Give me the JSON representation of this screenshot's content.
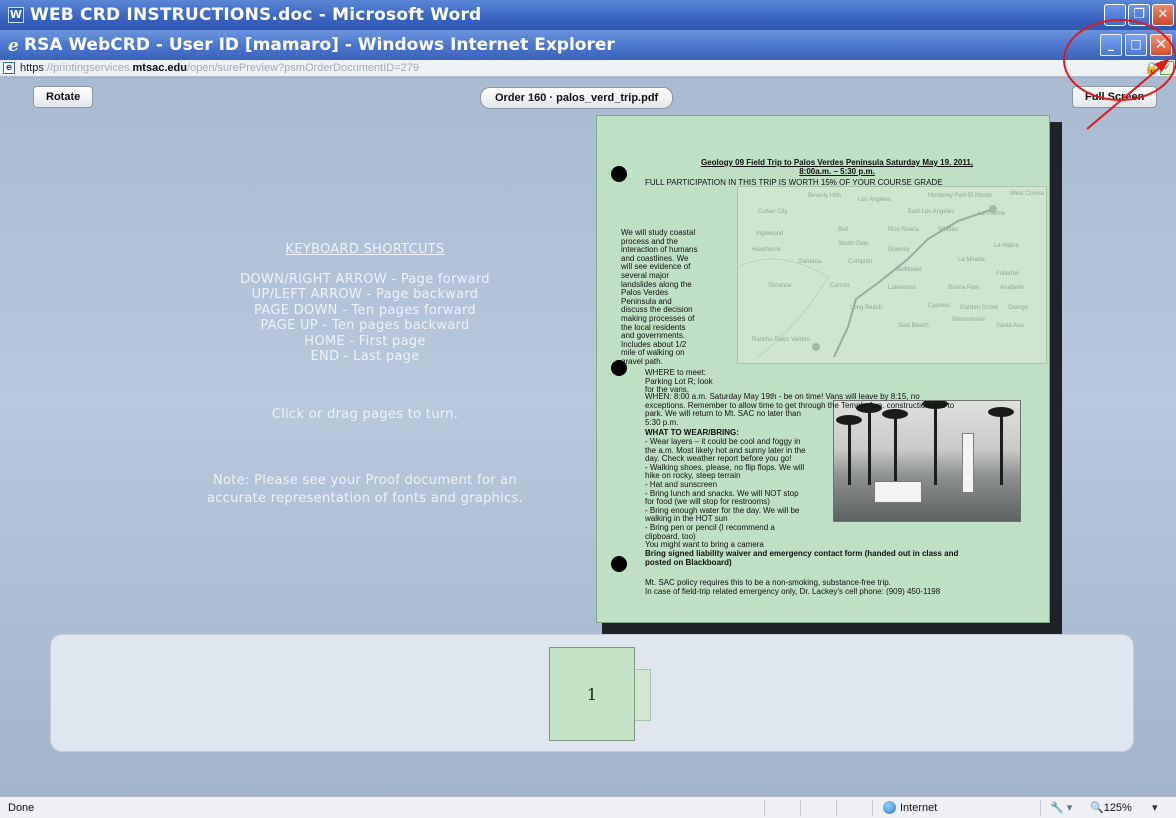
{
  "word_window": {
    "title": "WEB CRD INSTRUCTIONS.doc - Microsoft Word",
    "icon": "word-doc-icon",
    "buttons": {
      "minimize": "_",
      "restore": "❐",
      "close": "✕"
    }
  },
  "ie_window": {
    "title": "RSA WebCRD - User ID [mamaro] - Windows Internet Explorer",
    "icon": "ie-logo-icon",
    "buttons": {
      "minimize": "_",
      "maximize": "□",
      "close": "✕"
    }
  },
  "address_bar": {
    "scheme": "https",
    "sep": "://",
    "host_sub": "printingservices.",
    "host_main": "mtsac.edu",
    "path": "/open/surePreview?psmOrderDocumentID=279"
  },
  "viewer": {
    "rotate_label": "Rotate",
    "order_label": "Order 160 · palos_verd_trip.pdf",
    "fullscreen_label": "Full Screen",
    "shortcuts_title": "KEYBOARD SHORTCUTS",
    "shortcuts": [
      "DOWN/RIGHT ARROW - Page forward",
      "UP/LEFT ARROW - Page backward",
      "PAGE DOWN - Ten pages forward",
      "PAGE UP - Ten pages backward",
      "HOME - First page",
      "END - Last page"
    ],
    "drag_note": "Click or drag pages to turn.",
    "proof_note": "Note: Please see your Proof document for an accurate representation of fonts and graphics."
  },
  "document": {
    "title_line1": "Geology 09 Field Trip to Palos Verdes Peninsula Saturday May 19, 2011,",
    "title_line2": "8:00a.m. – 5:30 p.m.",
    "participation": "FULL PARTICIPATION IN THIS TRIP IS WORTH 15% OF YOUR COURSE GRADE",
    "intro_lines": [
      "We will study coastal",
      "process and the",
      "interaction of humans",
      "and coastlines. We",
      "will see evidence of",
      "several major",
      "landslides along the",
      "Palos Verdes",
      "Peninsula and",
      "discuss the decision",
      "making processes of",
      "the local residents",
      "and governments.",
      "Includes about 1/2",
      "mile of walking on",
      "gravel path."
    ],
    "where_lines": [
      "WHERE to meet:",
      "Parking Lot R; look",
      "for the vans."
    ],
    "when_lines": [
      "WHEN: 8:00 a.m. Saturday May 19th - be on time! Vans will leave by 8:15, no",
      "exceptions. Remember to allow time to get through the Temple Ave. construction and to",
      "park. We will return to Mt. SAC no later than",
      "5:30 p.m."
    ],
    "wear_title": "WHAT TO WEAR/BRING:",
    "wear_lines": [
      "- Wear layers – it could be cool and foggy in",
      "the a.m. Most likely hot and sunny later in the",
      "day. Check weather report before you go!",
      "- Walking shoes, please, no flip flops. We will",
      "hike on rocky, steep terrain",
      "- Hat and sunscreen",
      "- Bring lunch and snacks. We will NOT stop",
      "for food (we will stop for restrooms)",
      "- Bring enough water for the day. We will be",
      "walking in the HOT sun",
      "- Bring pen or pencil (I recommend a",
      "clipboard, too)",
      "You might want to bring a camera"
    ],
    "waiver_lines": [
      "Bring signed liability waiver and emergency contact form (handed out in class and",
      "posted on Blackboard)"
    ],
    "policy_lines": [
      "Mt. SAC policy requires this to be a non-smoking, substance-free trip.",
      "In case of field-trip related emergency only, Dr. Lackey's cell phone: (909) 450-1198"
    ],
    "map_labels": [
      "Beverly Hills",
      "Los Angeles",
      "Monterey Park",
      "El Monte",
      "West Covina",
      "Culver City",
      "East Los Angeles",
      "La Puente",
      "Inglewood",
      "Bell",
      "Pico Rivera",
      "Whittier",
      "Hawthorne",
      "South Gate",
      "Downey",
      "La Habra",
      "Gardena",
      "Compton",
      "Bellflower",
      "La Mirada",
      "Fullerton",
      "Torrance",
      "Carson",
      "Lakewood",
      "Buena Park",
      "Anaheim",
      "Long Beach",
      "Cypress",
      "Garden Grove",
      "Orange",
      "Seal Beach",
      "Westminster",
      "Santa Ana",
      "Rancho Palos Verdes"
    ]
  },
  "thumbnails": [
    {
      "label": "1"
    }
  ],
  "status_bar": {
    "status": "Done",
    "zone": "Internet",
    "protect": "🔧 ▾",
    "zoom": "🔍125%",
    "zoom_arrow": "▾"
  },
  "colors": {
    "annotation": "#e0191a",
    "page_green": "#bfe0c4"
  }
}
